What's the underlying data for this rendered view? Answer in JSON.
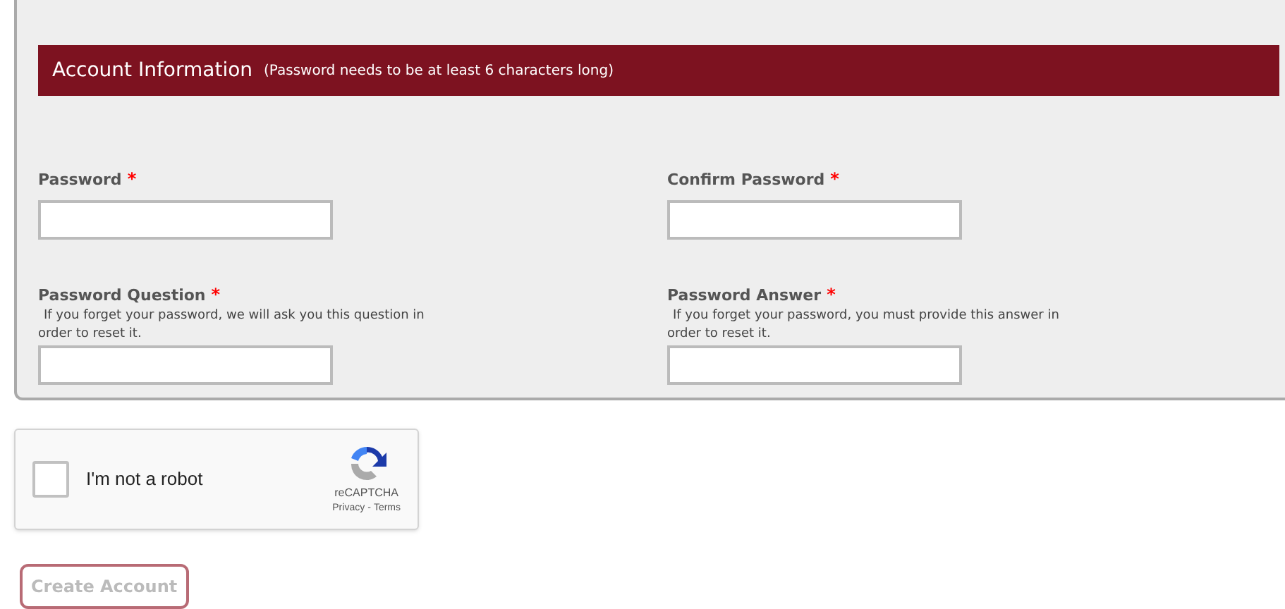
{
  "section": {
    "title": "Account Information",
    "note": "(Password needs to be at least 6 characters long)"
  },
  "fields": [
    {
      "label": "Password",
      "required_mark": "*"
    },
    {
      "label": "Confirm Password",
      "required_mark": "*"
    },
    {
      "label": "Password Question",
      "required_mark": "*",
      "hint": "If you forget your password, we will ask you this question in order to reset it."
    },
    {
      "label": "Password Answer",
      "required_mark": "*",
      "hint": "If you forget your password, you must provide this answer in order to reset it."
    }
  ],
  "captcha": {
    "label": "I'm not a robot",
    "checked": false,
    "brand": "reCAPTCHA",
    "privacy": "Privacy",
    "separator": "-",
    "terms": "Terms"
  },
  "submit": {
    "label": "Create Account",
    "disabled": true
  }
}
